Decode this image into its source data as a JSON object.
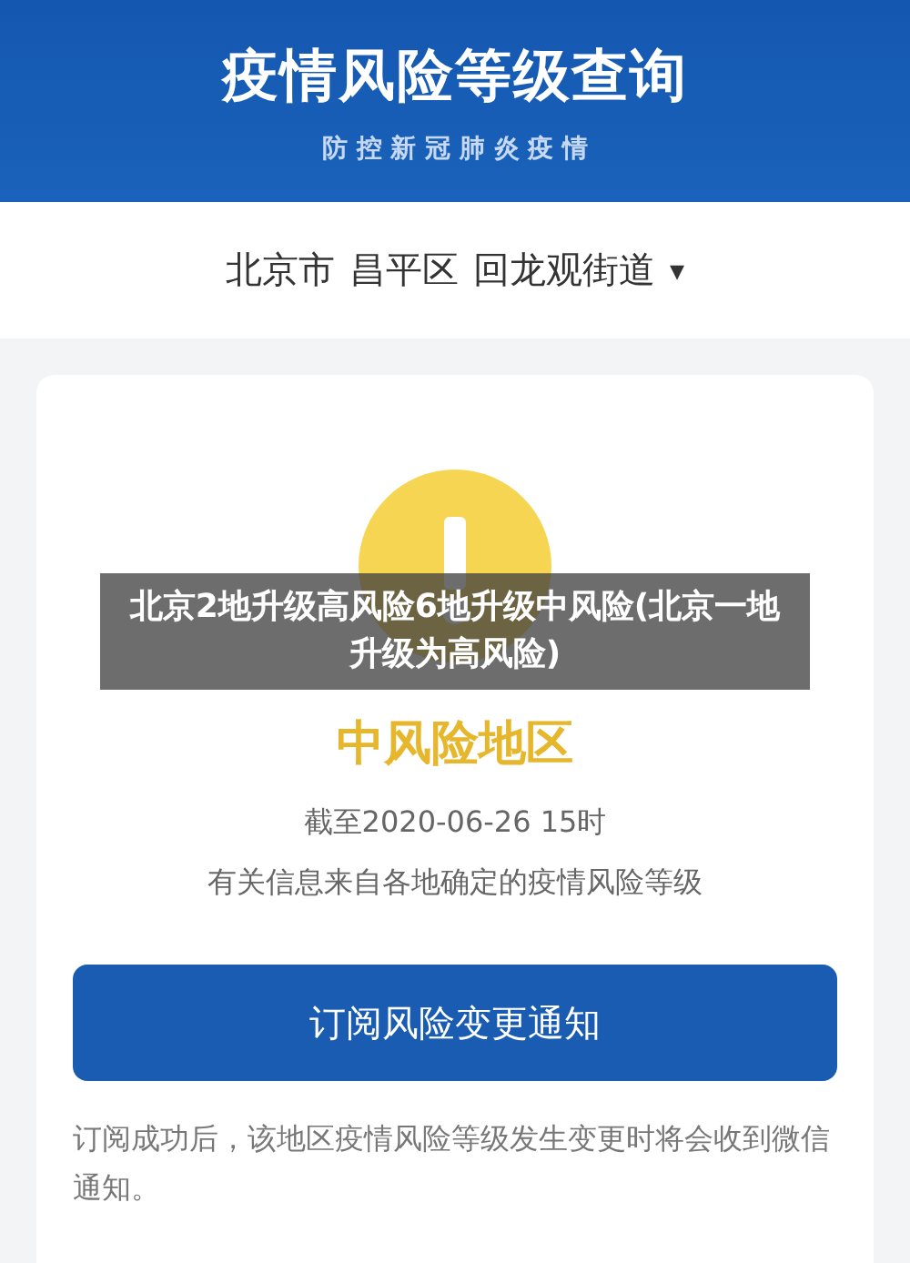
{
  "header": {
    "title": "疫情风险等级查询",
    "subtitle": "防 控 新 冠 肺 炎 疫 情"
  },
  "location": {
    "parts": [
      "北京市",
      "昌平区",
      "回龙观街道"
    ],
    "caret": "▾"
  },
  "result": {
    "kind": "medium",
    "label": "中风险地区",
    "as_of": "截至2020-06-26 15时",
    "source": "有关信息来自各地确定的疫情风险等级"
  },
  "subscribe_button": "订阅风险变更通知",
  "note": "订阅成功后，该地区疫情风险等级发生变更时将会收到微信通知。",
  "overlay_caption": "北京2地升级高风险6地升级中风险(北京一地升级为高风险)"
}
